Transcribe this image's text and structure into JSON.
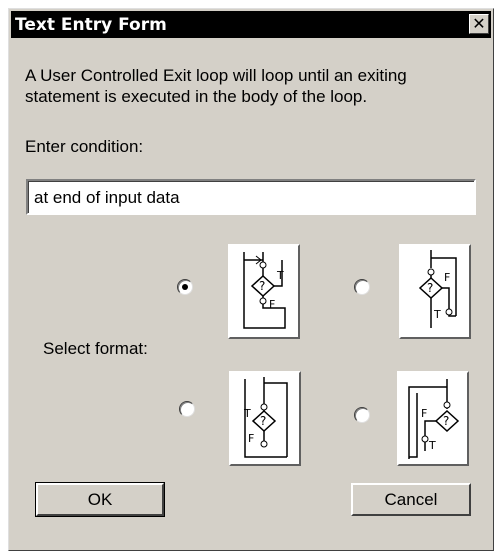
{
  "window": {
    "title": "Text Entry Form",
    "close_label": "✕"
  },
  "description": "A User Controlled Exit loop will loop until an exiting statement is executed in the body of the loop.",
  "condition": {
    "label": "Enter condition:",
    "value": "at end of input data"
  },
  "format": {
    "label": "Select format:",
    "selected_index": 0,
    "option_labels": [
      [
        "T",
        "F"
      ],
      [
        "F",
        "T"
      ],
      [
        "T",
        "F"
      ],
      [
        "F",
        "T"
      ]
    ]
  },
  "buttons": {
    "ok": "OK",
    "cancel": "Cancel"
  }
}
